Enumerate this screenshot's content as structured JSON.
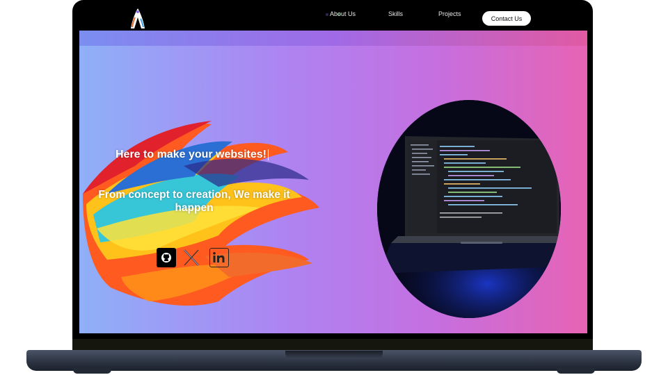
{
  "nav": {
    "links": [
      "About Us",
      "Skills",
      "Projects"
    ],
    "contact_label": "Contact Us"
  },
  "hero": {
    "headline": "Here to make your websites!",
    "subheadline": "From concept to creation, We make it happen"
  },
  "social": {
    "icons": [
      "github-icon",
      "x-icon",
      "linkedin-icon"
    ]
  },
  "colors": {
    "gradient_start": "#8fb0f8",
    "gradient_mid": "#ad84f2",
    "gradient_end": "#e763b4",
    "bezel": "#000000",
    "button_bg": "#ffffff"
  }
}
